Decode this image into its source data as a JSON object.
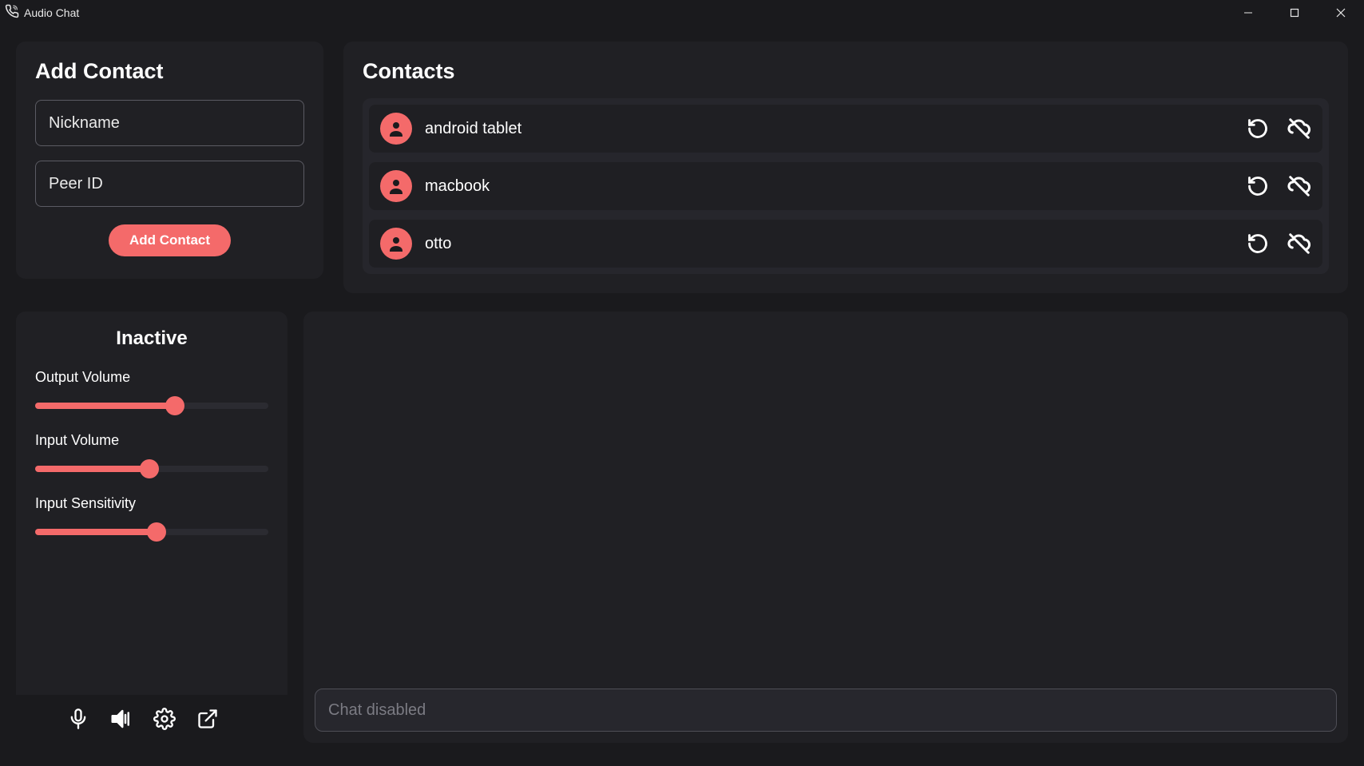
{
  "window": {
    "title": "Audio Chat"
  },
  "addContact": {
    "heading": "Add Contact",
    "nickname_placeholder": "Nickname",
    "peerid_placeholder": "Peer ID",
    "button_label": "Add Contact"
  },
  "contacts": {
    "heading": "Contacts",
    "items": [
      {
        "name": "android tablet"
      },
      {
        "name": "macbook"
      },
      {
        "name": "otto"
      }
    ]
  },
  "audio": {
    "status": "Inactive",
    "sliders": {
      "output": {
        "label": "Output Volume",
        "value": 60
      },
      "input": {
        "label": "Input Volume",
        "value": 49
      },
      "sensitivity": {
        "label": "Input Sensitivity",
        "value": 52
      }
    }
  },
  "chat": {
    "input_placeholder": "Chat disabled"
  },
  "colors": {
    "accent": "#f46a6a",
    "panel": "#202024",
    "panel_alt": "#26262c",
    "background": "#1a1a1d"
  }
}
